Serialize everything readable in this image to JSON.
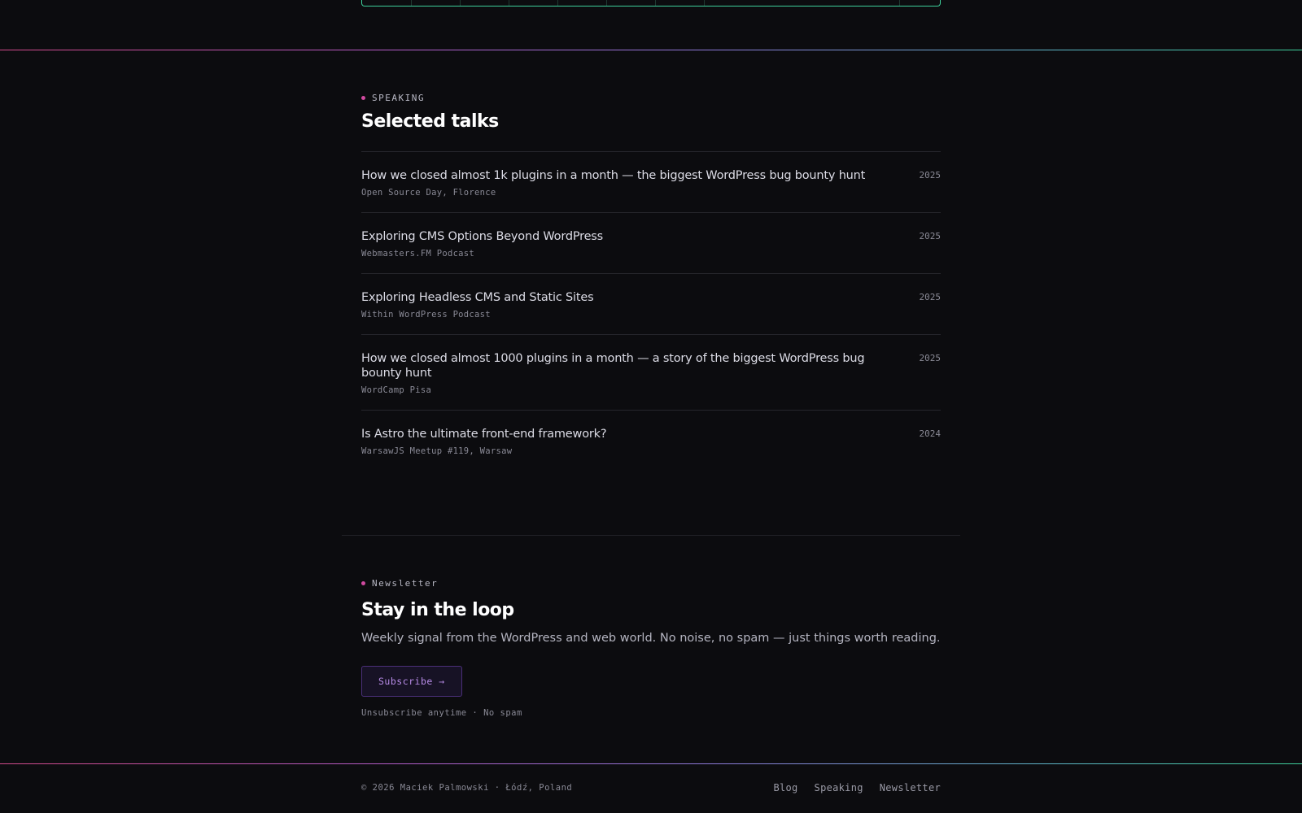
{
  "speaking": {
    "eyebrow": "SPEAKING",
    "title": "Selected talks",
    "talks": [
      {
        "title": "How we closed almost 1k plugins in a month — the biggest WordPress bug bounty hunt",
        "venue": "Open Source Day, Florence",
        "year": "2025"
      },
      {
        "title": "Exploring CMS Options Beyond WordPress",
        "venue": "Webmasters.FM Podcast",
        "year": "2025"
      },
      {
        "title": "Exploring Headless CMS and Static Sites",
        "venue": "Within WordPress Podcast",
        "year": "2025"
      },
      {
        "title": "How we closed almost 1000 plugins in a month — a story of the biggest WordPress bug bounty hunt",
        "venue": "WordCamp Pisa",
        "year": "2025"
      },
      {
        "title": "Is Astro the ultimate front-end framework?",
        "venue": "WarsawJS Meetup #119, Warsaw",
        "year": "2024"
      }
    ]
  },
  "newsletter": {
    "eyebrow": "Newsletter",
    "title": "Stay in the loop",
    "description": "Weekly signal from the WordPress and web world. No noise, no spam — just things worth reading.",
    "button_label": "Subscribe →",
    "note": "Unsubscribe anytime · No spam"
  },
  "footer": {
    "copyright": "© 2026 Maciek Palmowski · Łódź, Poland",
    "nav": [
      "Blog",
      "Speaking",
      "Newsletter"
    ]
  },
  "colors": {
    "background": "#0c0c0f",
    "accent_pink": "#d14aa0",
    "accent_green": "#3ecf9a",
    "button_text": "#b88ce8"
  }
}
